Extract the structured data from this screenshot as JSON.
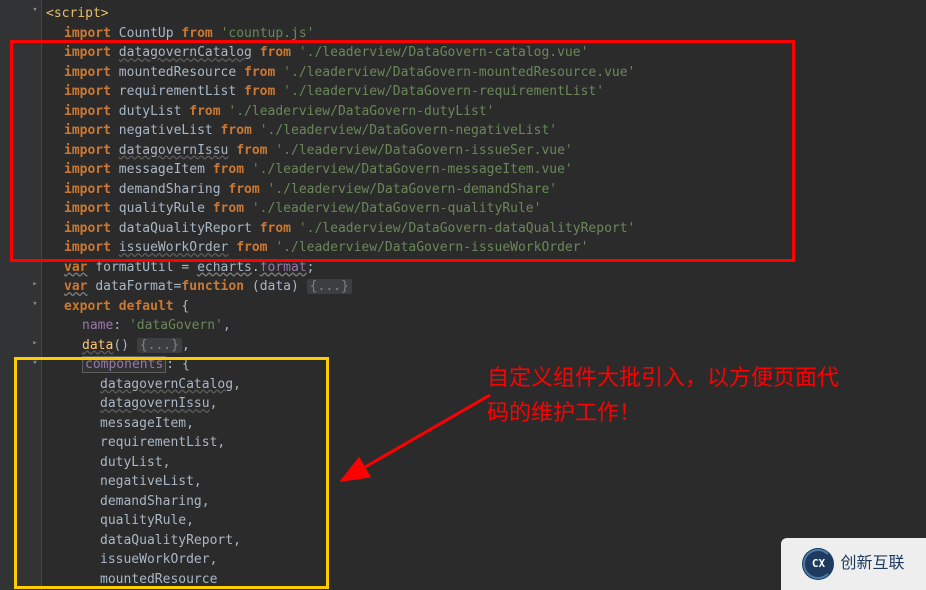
{
  "code": {
    "tag_open": "<script>",
    "imports": [
      {
        "name": "CountUp",
        "path": "'countup.js'"
      },
      {
        "name": "datagovernCatalog",
        "path": "'./leaderview/DataGovern-catalog.vue'"
      },
      {
        "name": "mountedResource",
        "path": "'./leaderview/DataGovern-mountedResource.vue'"
      },
      {
        "name": "requirementList",
        "path": "'./leaderview/DataGovern-requirementList'"
      },
      {
        "name": "dutyList",
        "path": "'./leaderview/DataGovern-dutyList'"
      },
      {
        "name": "negativeList",
        "path": "'./leaderview/DataGovern-negativeList'"
      },
      {
        "name": "datagovernIssu",
        "path": "'./leaderview/DataGovern-issueSer.vue'"
      },
      {
        "name": "messageItem",
        "path": "'./leaderview/DataGovern-messageItem.vue'"
      },
      {
        "name": "demandSharing",
        "path": "'./leaderview/DataGovern-demandShare'"
      },
      {
        "name": "qualityRule",
        "path": "'./leaderview/DataGovern-qualityRule'"
      },
      {
        "name": "dataQualityReport",
        "path": "'./leaderview/DataGovern-dataQualityReport'"
      },
      {
        "name": "issueWorkOrder",
        "path": "'./leaderview/DataGovern-issueWorkOrder'"
      }
    ],
    "var1_kw": "var",
    "var1_name": "formatUtil",
    "var1_eq": " = ",
    "var1_obj": "echarts",
    "var1_dot": ".",
    "var1_prop": "format",
    "semicolon": ";",
    "var2_kw": "var",
    "var2_name": "dataFormat",
    "var2_eq": "=",
    "var2_fn": "function",
    "var2_args": " (data) ",
    "var2_fold": "{...}",
    "export_kw": "export default",
    "export_brace": " {",
    "name_key": "name",
    "name_val": "'dataGovern'",
    "comma": ",",
    "data_key": "data",
    "data_paren": "() ",
    "data_fold": "{...}",
    "components_key": "components",
    "colon": ": ",
    "brace_open": "{",
    "components": [
      "datagovernCatalog",
      "datagovernIssu",
      "messageItem",
      "requirementList",
      "dutyList",
      "negativeList",
      "demandSharing",
      "qualityRule",
      "dataQualityReport",
      "issueWorkOrder",
      "mountedResource"
    ]
  },
  "annotation": {
    "line1": "自定义组件大批引入，以方便页面代",
    "line2": "码的维护工作！"
  },
  "watermark": {
    "logo": "CX",
    "text": "创新互联"
  }
}
